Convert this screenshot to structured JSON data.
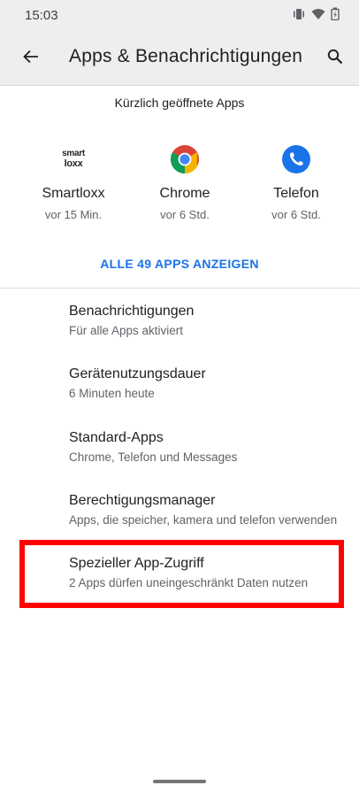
{
  "status_bar": {
    "time": "15:03",
    "icons": [
      "vibrate-icon",
      "wifi-icon",
      "battery-icon"
    ]
  },
  "app_bar": {
    "title": "Apps & Benachrichtigungen",
    "back_icon": "arrow-back-icon",
    "search_icon": "search-icon"
  },
  "recent": {
    "header": "Kürzlich geöffnete Apps",
    "apps": [
      {
        "name": "Smartloxx",
        "time": "vor 15 Min.",
        "icon": "smartloxx-logo",
        "logo_line1": "smart",
        "logo_line2": "loxx"
      },
      {
        "name": "Chrome",
        "time": "vor 6 Std.",
        "icon": "chrome-icon"
      },
      {
        "name": "Telefon",
        "time": "vor 6 Std.",
        "icon": "phone-icon"
      }
    ],
    "see_all": "ALLE 49 APPS ANZEIGEN"
  },
  "settings": [
    {
      "title": "Benachrichtigungen",
      "subtitle": "Für alle Apps aktiviert"
    },
    {
      "title": "Gerätenutzungsdauer",
      "subtitle": "6 Minuten heute"
    },
    {
      "title": "Standard-Apps",
      "subtitle": "Chrome, Telefon und Messages"
    },
    {
      "title": "Berechtigungsmanager",
      "subtitle": "Apps, die speicher, kamera und telefon verwenden"
    },
    {
      "title": "Spezieller App-Zugriff",
      "subtitle": "2 Apps dürfen uneingeschränkt Daten nutzen"
    }
  ],
  "colors": {
    "accent": "#1a73e8",
    "highlight": "#ff0000",
    "chrome_red": "#db4437",
    "chrome_yellow": "#f4b400",
    "chrome_green": "#0f9d58",
    "chrome_blue": "#4285f4",
    "phone_blue": "#1a73e8"
  }
}
